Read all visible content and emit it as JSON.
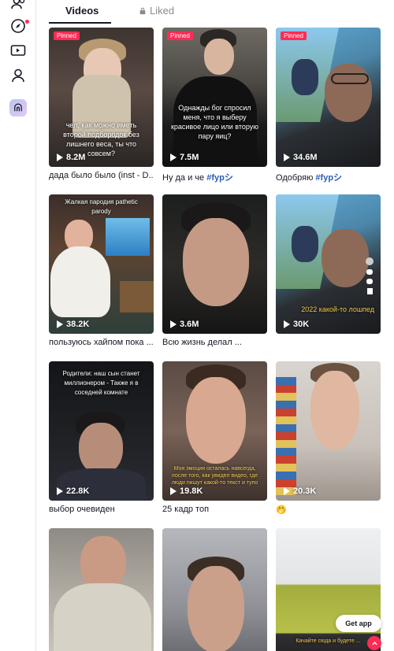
{
  "tabs": {
    "videos": "Videos",
    "liked": "Liked"
  },
  "sidebar": {
    "icons": [
      "following-icon",
      "explore-icon",
      "live-icon",
      "profile-icon",
      "more-icon"
    ]
  },
  "videos": [
    {
      "pinned": "Pinned",
      "views": "8.2M",
      "caption": "дада было было (inst - D...",
      "tag": "",
      "overlay": "чел, как можно иметь второй подбородок без лишнего веса, ты что совсем?"
    },
    {
      "pinned": "Pinned",
      "views": "7.5M",
      "caption": "Ну да и че ",
      "tag": "#fypシ",
      "overlay": "Однажды бог спросил меня, что я выберу красивое лицо или вторую пару яиц?"
    },
    {
      "pinned": "Pinned",
      "views": "34.6M",
      "caption": "Одобряю ",
      "tag": "#fypシ",
      "overlay": ""
    },
    {
      "pinned": "",
      "views": "38.2K",
      "caption": "пользуюсь хайпом пока ...",
      "tag": "",
      "overlay": "Жалкая пародия pathetic parody"
    },
    {
      "pinned": "",
      "views": "3.6M",
      "caption": "Всю жизнь делал ...",
      "tag": "",
      "overlay": ""
    },
    {
      "pinned": "",
      "views": "30K",
      "caption": "",
      "tag": "",
      "overlay": "2022 какой-то лошпед"
    },
    {
      "pinned": "",
      "views": "22.8K",
      "caption": "выбор очевиден",
      "tag": "",
      "overlay": "Родители: наш сын станет миллионером - Также я в соседней комнате"
    },
    {
      "pinned": "",
      "views": "19.8K",
      "caption": "25 кадр топ",
      "tag": "",
      "overlay": "Моя эмоция осталась навсегда, после того, как увидел видео, где люди пишут какой-то текст и тупо"
    },
    {
      "pinned": "",
      "views": "20.3K",
      "caption": "🤭",
      "tag": "",
      "overlay": ""
    },
    {
      "pinned": "",
      "views": "",
      "caption": "",
      "tag": "",
      "overlay": ""
    },
    {
      "pinned": "",
      "views": "",
      "caption": "",
      "tag": "",
      "overlay": ""
    },
    {
      "pinned": "",
      "views": "",
      "caption": "",
      "tag": "",
      "overlay": "Качайте сюда и будете ..."
    }
  ],
  "get_app": "Get app",
  "colors": {
    "accent": "#fe2c55",
    "tag": "#2b5db9",
    "text": "#161823"
  }
}
